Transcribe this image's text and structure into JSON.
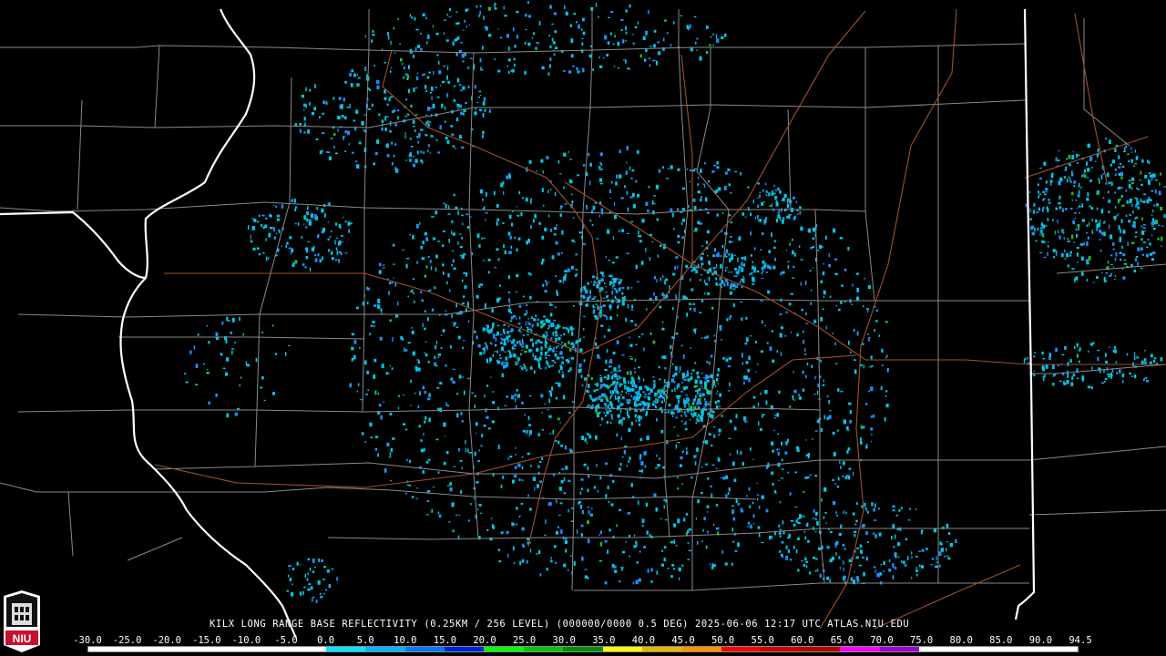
{
  "caption": "KILX LONG RANGE BASE REFLECTIVITY (0.25KM / 256 LEVEL) (000000/0000 0.5 DEG) 2025-06-06 12:17 UTC  ATLAS.NIU.EDU",
  "logo_text": "NIU",
  "legend": {
    "labels": [
      "-30.0",
      "-25.0",
      "-20.0",
      "-15.0",
      "-10.0",
      "-5.0",
      "0.0",
      "5.0",
      "10.0",
      "15.0",
      "20.0",
      "25.0",
      "30.0",
      "35.0",
      "40.0",
      "45.0",
      "50.0",
      "55.0",
      "60.0",
      "65.0",
      "70.0",
      "75.0",
      "80.0",
      "85.0",
      "90.0",
      "94.5"
    ],
    "colors": [
      "#ffffff",
      "#ffffff",
      "#ffffff",
      "#ffffff",
      "#ffffff",
      "#ffffff",
      "#00e6ff",
      "#00b4ff",
      "#0078ff",
      "#0020e0",
      "#00ff00",
      "#00c800",
      "#009000",
      "#ffff00",
      "#e6b400",
      "#ff9000",
      "#ff0000",
      "#d00000",
      "#b40000",
      "#ff00ff",
      "#a000d0",
      "#ffffff",
      "#ffffff",
      "#ffffff",
      "#ffffff"
    ]
  },
  "colors": {
    "background": "#000000",
    "county_lines": "#8a8a8a",
    "state_lines": "#ffffff",
    "highways": "#a0522d",
    "echo_light": "#00c8e6",
    "echo_mid": "#1e90ff",
    "echo_strong": "#20c020"
  }
}
